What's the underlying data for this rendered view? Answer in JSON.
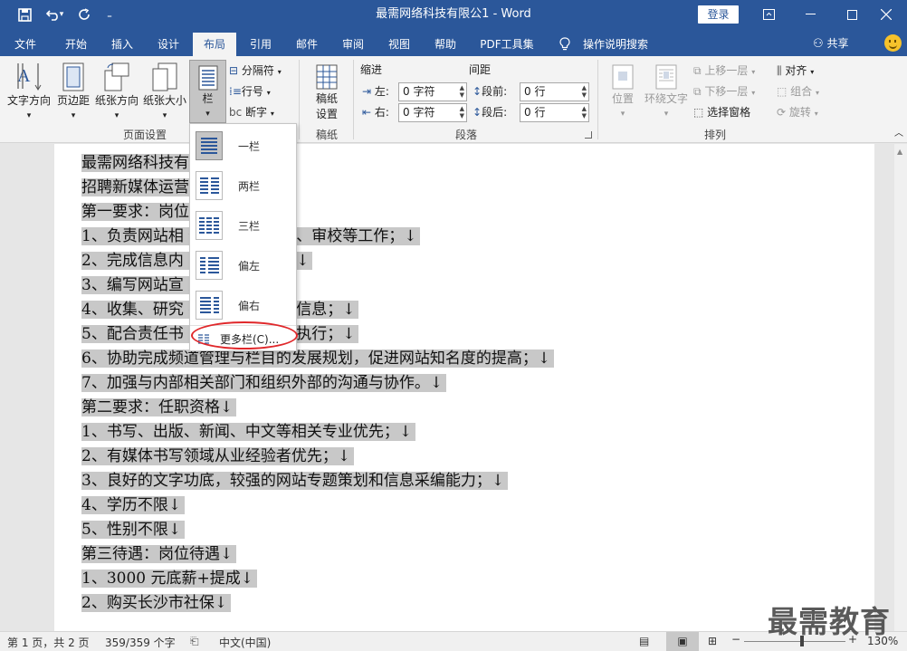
{
  "titlebar": {
    "title": "最需网络科技有限公1  -  Word",
    "login_label": "登录"
  },
  "tabs": [
    "文件",
    "开始",
    "插入",
    "设计",
    "布局",
    "引用",
    "邮件",
    "审阅",
    "视图",
    "帮助",
    "PDF工具集",
    "操作说明搜索"
  ],
  "active_tab": "布局",
  "share_label": "共享",
  "ribbon": {
    "page_setup": {
      "group_label": "页面设置",
      "text_direction": "文字方向",
      "margins": "页边距",
      "orientation": "纸张方向",
      "size": "纸张大小",
      "columns": "栏",
      "breaks": "分隔符",
      "line_numbers": "行号",
      "hyphenation": "断字"
    },
    "manuscript": {
      "group_label": "稿纸",
      "button_line1": "稿纸",
      "button_line2": "设置"
    },
    "paragraph": {
      "group_label": "段落",
      "indent_title": "缩进",
      "spacing_title": "间距",
      "left_label": "左:",
      "right_label": "右:",
      "before_label": "段前:",
      "after_label": "段后:",
      "left_value": "0 字符",
      "right_value": "0 字符",
      "before_value": "0 行",
      "after_value": "0 行"
    },
    "arrange": {
      "group_label": "排列",
      "position": "位置",
      "wrap_text": "环绕文字",
      "bring_forward": "上移一层",
      "send_backward": "下移一层",
      "selection_pane": "选择窗格",
      "align": "对齐",
      "group": "组合",
      "rotate": "旋转"
    }
  },
  "columns_menu": {
    "items": [
      "一栏",
      "两栏",
      "三栏",
      "偏左",
      "偏右"
    ],
    "more": "更多栏(C)..."
  },
  "document": {
    "lines": [
      "最需网络科技有",
      "招聘新媒体运营",
      "第一要求：岗位",
      "1、负责网站相        信息搜集、书写、审校等工作；↓",
      "2、完成信息内        常更新与维护；↓",
      "3、编写网站宣        产品资料；↓",
      "4、收集、研究        者的意见和反馈信息；↓",
      "5、配合责任书        广活动，并参与执行；↓",
      "6、协助完成频道管理与栏目的发展规划，促进网站知名度的提高；↓",
      "7、加强与内部相关部门和组织外部的沟通与协作。↓",
      "第二要求：任职资格↓",
      "1、书写、出版、新闻、中文等相关专业优先；↓",
      "2、有媒体书写领域从业经验者优先；↓",
      "3、良好的文字功底，较强的网站专题策划和信息采编能力；↓",
      "4、学历不限↓",
      "5、性别不限↓",
      "第三待遇：岗位待遇↓",
      "1、3000 元底薪+提成↓",
      "2、购买长沙市社保↓"
    ]
  },
  "statusbar": {
    "page": "第 1 页，共 2 页",
    "words": "359/359 个字",
    "language": "中文(中国)",
    "zoom": "130%"
  },
  "watermark": "最需教育",
  "colors": {
    "brand": "#2b579a",
    "highlight": "#c8c8c8",
    "annotation": "#e0282b"
  }
}
